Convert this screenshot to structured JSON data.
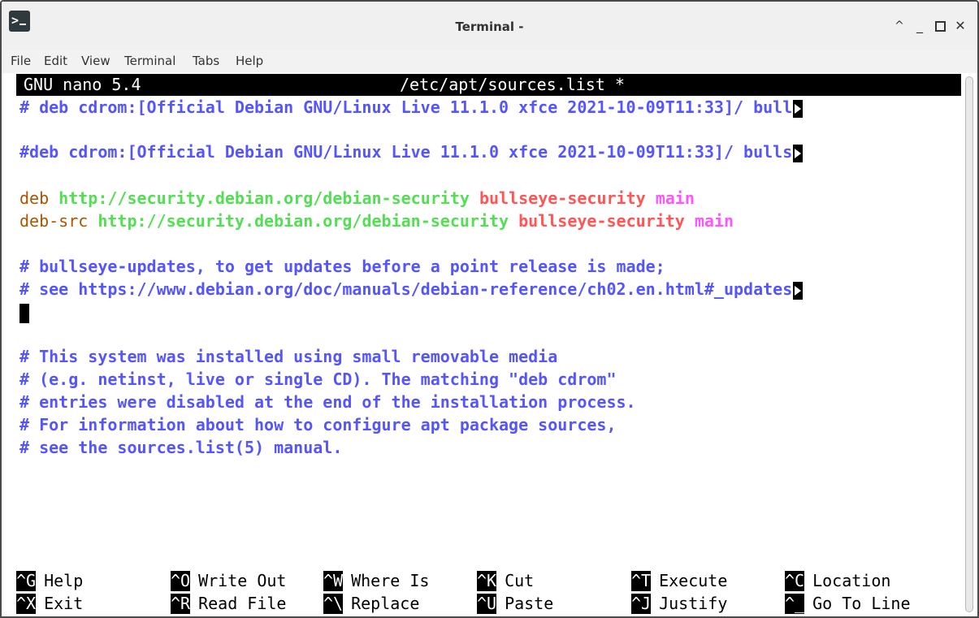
{
  "window": {
    "title": "Terminal -",
    "buttons": {
      "shade": "^",
      "minimize": "_",
      "maximize": "",
      "close": "x"
    }
  },
  "menu": [
    "File",
    "Edit",
    "View",
    "Terminal",
    "Tabs",
    "Help"
  ],
  "nano": {
    "version": "GNU nano 5.4",
    "filename": "/etc/apt/sources.list *"
  },
  "file_lines": {
    "l1": "# deb cdrom:[Official Debian GNU/Linux Live 11.1.0 xfce 2021-10-09T11:33]/ bull",
    "l3": "#deb cdrom:[Official Debian GNU/Linux Live 11.1.0 xfce 2021-10-09T11:33]/ bulls",
    "l5": {
      "kw": "deb",
      "url": "http://security.debian.org/debian-security",
      "suite": "bullseye-security",
      "comp": "main"
    },
    "l6": {
      "kw": "deb-src",
      "url": "http://security.debian.org/debian-security",
      "suite": "bullseye-security",
      "comp": "main"
    },
    "l8": "# bullseye-updates, to get updates before a point release is made;",
    "l9": "# see https://www.debian.org/doc/manuals/debian-reference/ch02.en.html#_updates",
    "l12": "# This system was installed using small removable media",
    "l13": "# (e.g. netinst, live or single CD). The matching \"deb cdrom\"",
    "l14": "# entries were disabled at the end of the installation process.",
    "l15": "# For information about how to configure apt package sources,",
    "l16": "# see the sources.list(5) manual."
  },
  "shortcuts": [
    {
      "key": "^G",
      "label": "Help"
    },
    {
      "key": "^O",
      "label": "Write Out"
    },
    {
      "key": "^W",
      "label": "Where Is"
    },
    {
      "key": "^K",
      "label": "Cut"
    },
    {
      "key": "^T",
      "label": "Execute"
    },
    {
      "key": "^C",
      "label": "Location"
    },
    {
      "key": "^X",
      "label": "Exit"
    },
    {
      "key": "^R",
      "label": "Read File"
    },
    {
      "key": "^\\",
      "label": "Replace"
    },
    {
      "key": "^U",
      "label": "Paste"
    },
    {
      "key": "^J",
      "label": "Justify"
    },
    {
      "key": "^_",
      "label": "Go To Line"
    }
  ],
  "colors": {
    "comment": "#5555ff",
    "keyword": "#aa5500",
    "url": "#55dd55",
    "suite": "#ff5555",
    "component": "#ff55ff",
    "header_bg": "#000000"
  },
  "icons": {
    "app": "terminal-app-icon",
    "overflow": "line-overflow-indicator"
  }
}
